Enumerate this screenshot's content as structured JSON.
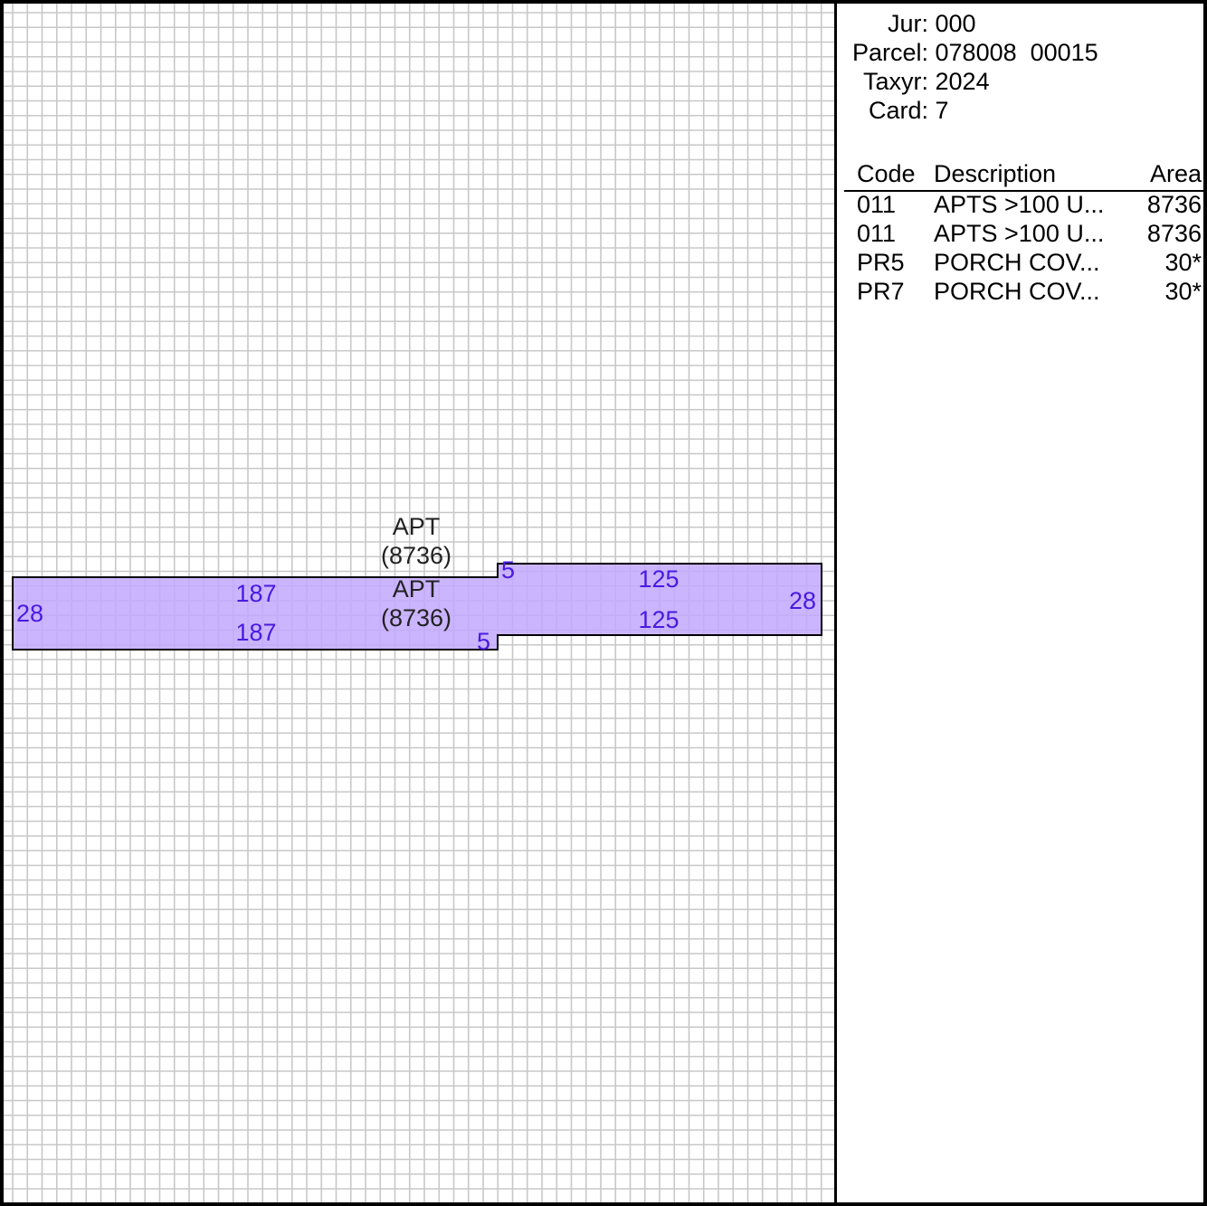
{
  "colors": {
    "grid_line": "#c8c8c8",
    "shape_fill": "#c2a8ff",
    "shape_stroke": "#000000",
    "dimension_text": "#4a1ae0",
    "label_text": "#222222"
  },
  "header": {
    "jur": {
      "label": "Jur:",
      "value": "000"
    },
    "parcel": {
      "label": "Parcel:",
      "value": "078008  00015"
    },
    "taxyr": {
      "label": "Taxyr:",
      "value": "2024"
    },
    "card": {
      "label": "Card:",
      "value": "7"
    }
  },
  "table": {
    "columns": {
      "code": "Code",
      "description": "Description",
      "area": "Area"
    },
    "rows": [
      {
        "code": "011",
        "description": "APTS >100 U...",
        "area": "8736"
      },
      {
        "code": "011",
        "description": "APTS >100 U...",
        "area": "8736"
      },
      {
        "code": "PR5",
        "description": "PORCH COV...",
        "area": "30*"
      },
      {
        "code": "PR7",
        "description": "PORCH COV...",
        "area": "30*"
      }
    ]
  },
  "sketch": {
    "labels": {
      "apt_top": "APT",
      "area_top": "(8736)",
      "apt_bottom": "APT",
      "area_bottom": "(8736)"
    },
    "dimensions": {
      "left_side": "28",
      "left_top": "187",
      "left_bottom": "187",
      "step_top": "5",
      "step_bottom": "5",
      "right_top": "125",
      "right_bottom": "125",
      "right_side": "28"
    }
  }
}
